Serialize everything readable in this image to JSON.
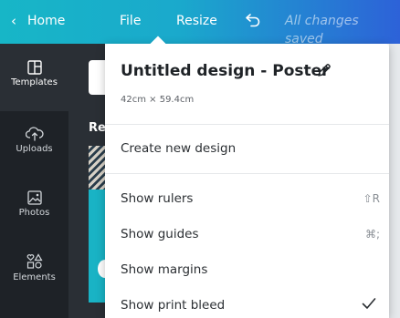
{
  "topbar": {
    "home_label": "Home",
    "file_label": "File",
    "resize_label": "Resize",
    "status_text": "All changes saved"
  },
  "sidebar": {
    "items": [
      {
        "label": "Templates",
        "icon": "templates-icon"
      },
      {
        "label": "Uploads",
        "icon": "cloud-upload-icon"
      },
      {
        "label": "Photos",
        "icon": "photo-icon"
      },
      {
        "label": "Elements",
        "icon": "shapes-icon"
      }
    ]
  },
  "panel": {
    "section_label_partial": "Re"
  },
  "menu": {
    "design_title": "Untitled design - Poster",
    "dimensions": "42cm × 59.4cm",
    "items": [
      {
        "label": "Create new design"
      },
      {
        "label": "Show rulers",
        "shortcut": "⇧R"
      },
      {
        "label": "Show guides",
        "shortcut": "⌘;"
      },
      {
        "label": "Show margins"
      },
      {
        "label": "Show print bleed",
        "checked": true
      }
    ]
  }
}
